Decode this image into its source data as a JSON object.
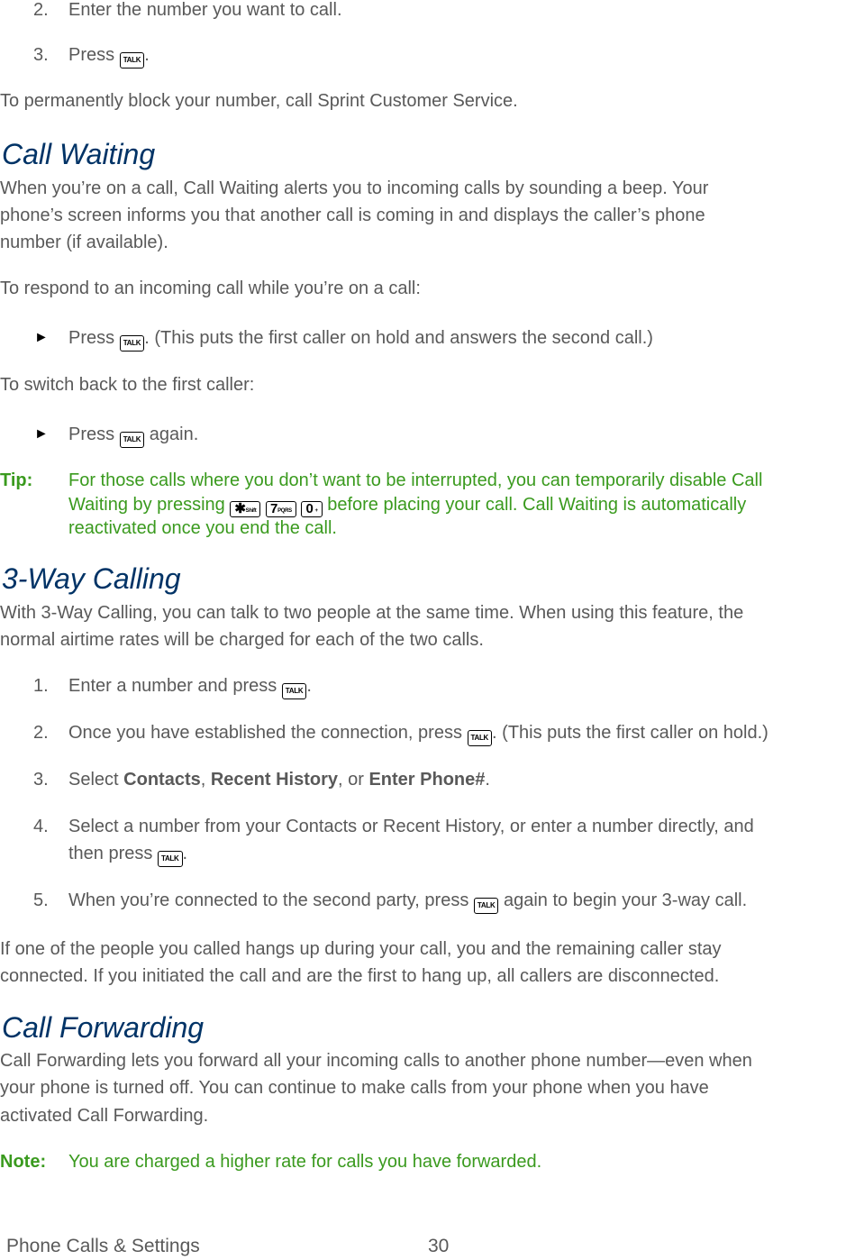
{
  "steps_top": [
    {
      "num": "2.",
      "text": "Enter the number you want to call."
    },
    {
      "num": "3.",
      "text_before": "Press ",
      "key": "TALK",
      "text_after": "."
    }
  ],
  "block_note": "To permanently block your number, call Sprint Customer Service.",
  "call_waiting": {
    "title": "Call Waiting",
    "para_lines": [
      "When you’re on a call, Call Waiting alerts you to incoming calls by sounding a beep. Your",
      "phone’s screen informs you that another call is coming in and displays the caller’s phone",
      "number (if available)."
    ],
    "respond_intro": "To respond to an incoming call while you’re on a call:",
    "bullet1": {
      "before": "Press ",
      "key": "TALK",
      "after": ". (This puts the first caller on hold and answers the second call.)"
    },
    "switch_intro": "To switch back to the first caller:",
    "bullet2": {
      "before": "Press ",
      "key": "TALK",
      "after": " again."
    },
    "tip": {
      "label": "Tip:",
      "line1": "For those calls where you don’t want to be interrupted, you can temporarily disable Call",
      "line2_before": "Waiting by pressing ",
      "keys": [
        {
          "main": "✱",
          "sub": "Shift"
        },
        {
          "main": "7",
          "sub": "PQRS"
        },
        {
          "main": "0",
          "sub": "+"
        }
      ],
      "line2_after": " before placing your call. Call Waiting is automatically",
      "line3": "reactivated once you end the call."
    }
  },
  "three_way": {
    "title": "3-Way Calling",
    "para_lines": [
      "With 3-Way Calling, you can talk to two people at the same time. When using this feature, the",
      "normal airtime rates will be charged for each of the two calls."
    ],
    "steps": [
      {
        "num": "1.",
        "before": "Enter a number and press ",
        "key": "TALK",
        "after": "."
      },
      {
        "num": "2.",
        "before": "Once you have established the connection, press ",
        "key": "TALK",
        "after": ". (This puts the first caller on hold.)"
      },
      {
        "num": "3.",
        "before": "Select ",
        "b1": "Contacts",
        "sep1": ", ",
        "b2": "Recent History",
        "sep2": ", or ",
        "b3": "Enter Phone#",
        "after": "."
      },
      {
        "num": "4.",
        "line1": "Select a number from your Contacts or Recent History, or enter a number directly, and",
        "before": "then press ",
        "key": "TALK",
        "after": "."
      },
      {
        "num": "5.",
        "before": "When you’re connected to the second party, press ",
        "key": "TALK",
        "after": " again to begin your 3-way call."
      }
    ],
    "hangup_lines": [
      "If one of the people you called hangs up during your call, you and the remaining caller stay",
      "connected. If you initiated the call and are the first to hang up, all callers are disconnected."
    ]
  },
  "call_forwarding": {
    "title": "Call Forwarding",
    "para_lines": [
      "Call Forwarding lets you forward all your incoming calls to another phone number—even when",
      "your phone is turned off. You can continue to make calls from your phone when you have",
      "activated Call Forwarding."
    ],
    "note": {
      "label": "Note:",
      "text": "You are charged a higher rate for calls you have forwarded."
    }
  },
  "footer": {
    "section": "Phone Calls & Settings",
    "page": "30"
  }
}
